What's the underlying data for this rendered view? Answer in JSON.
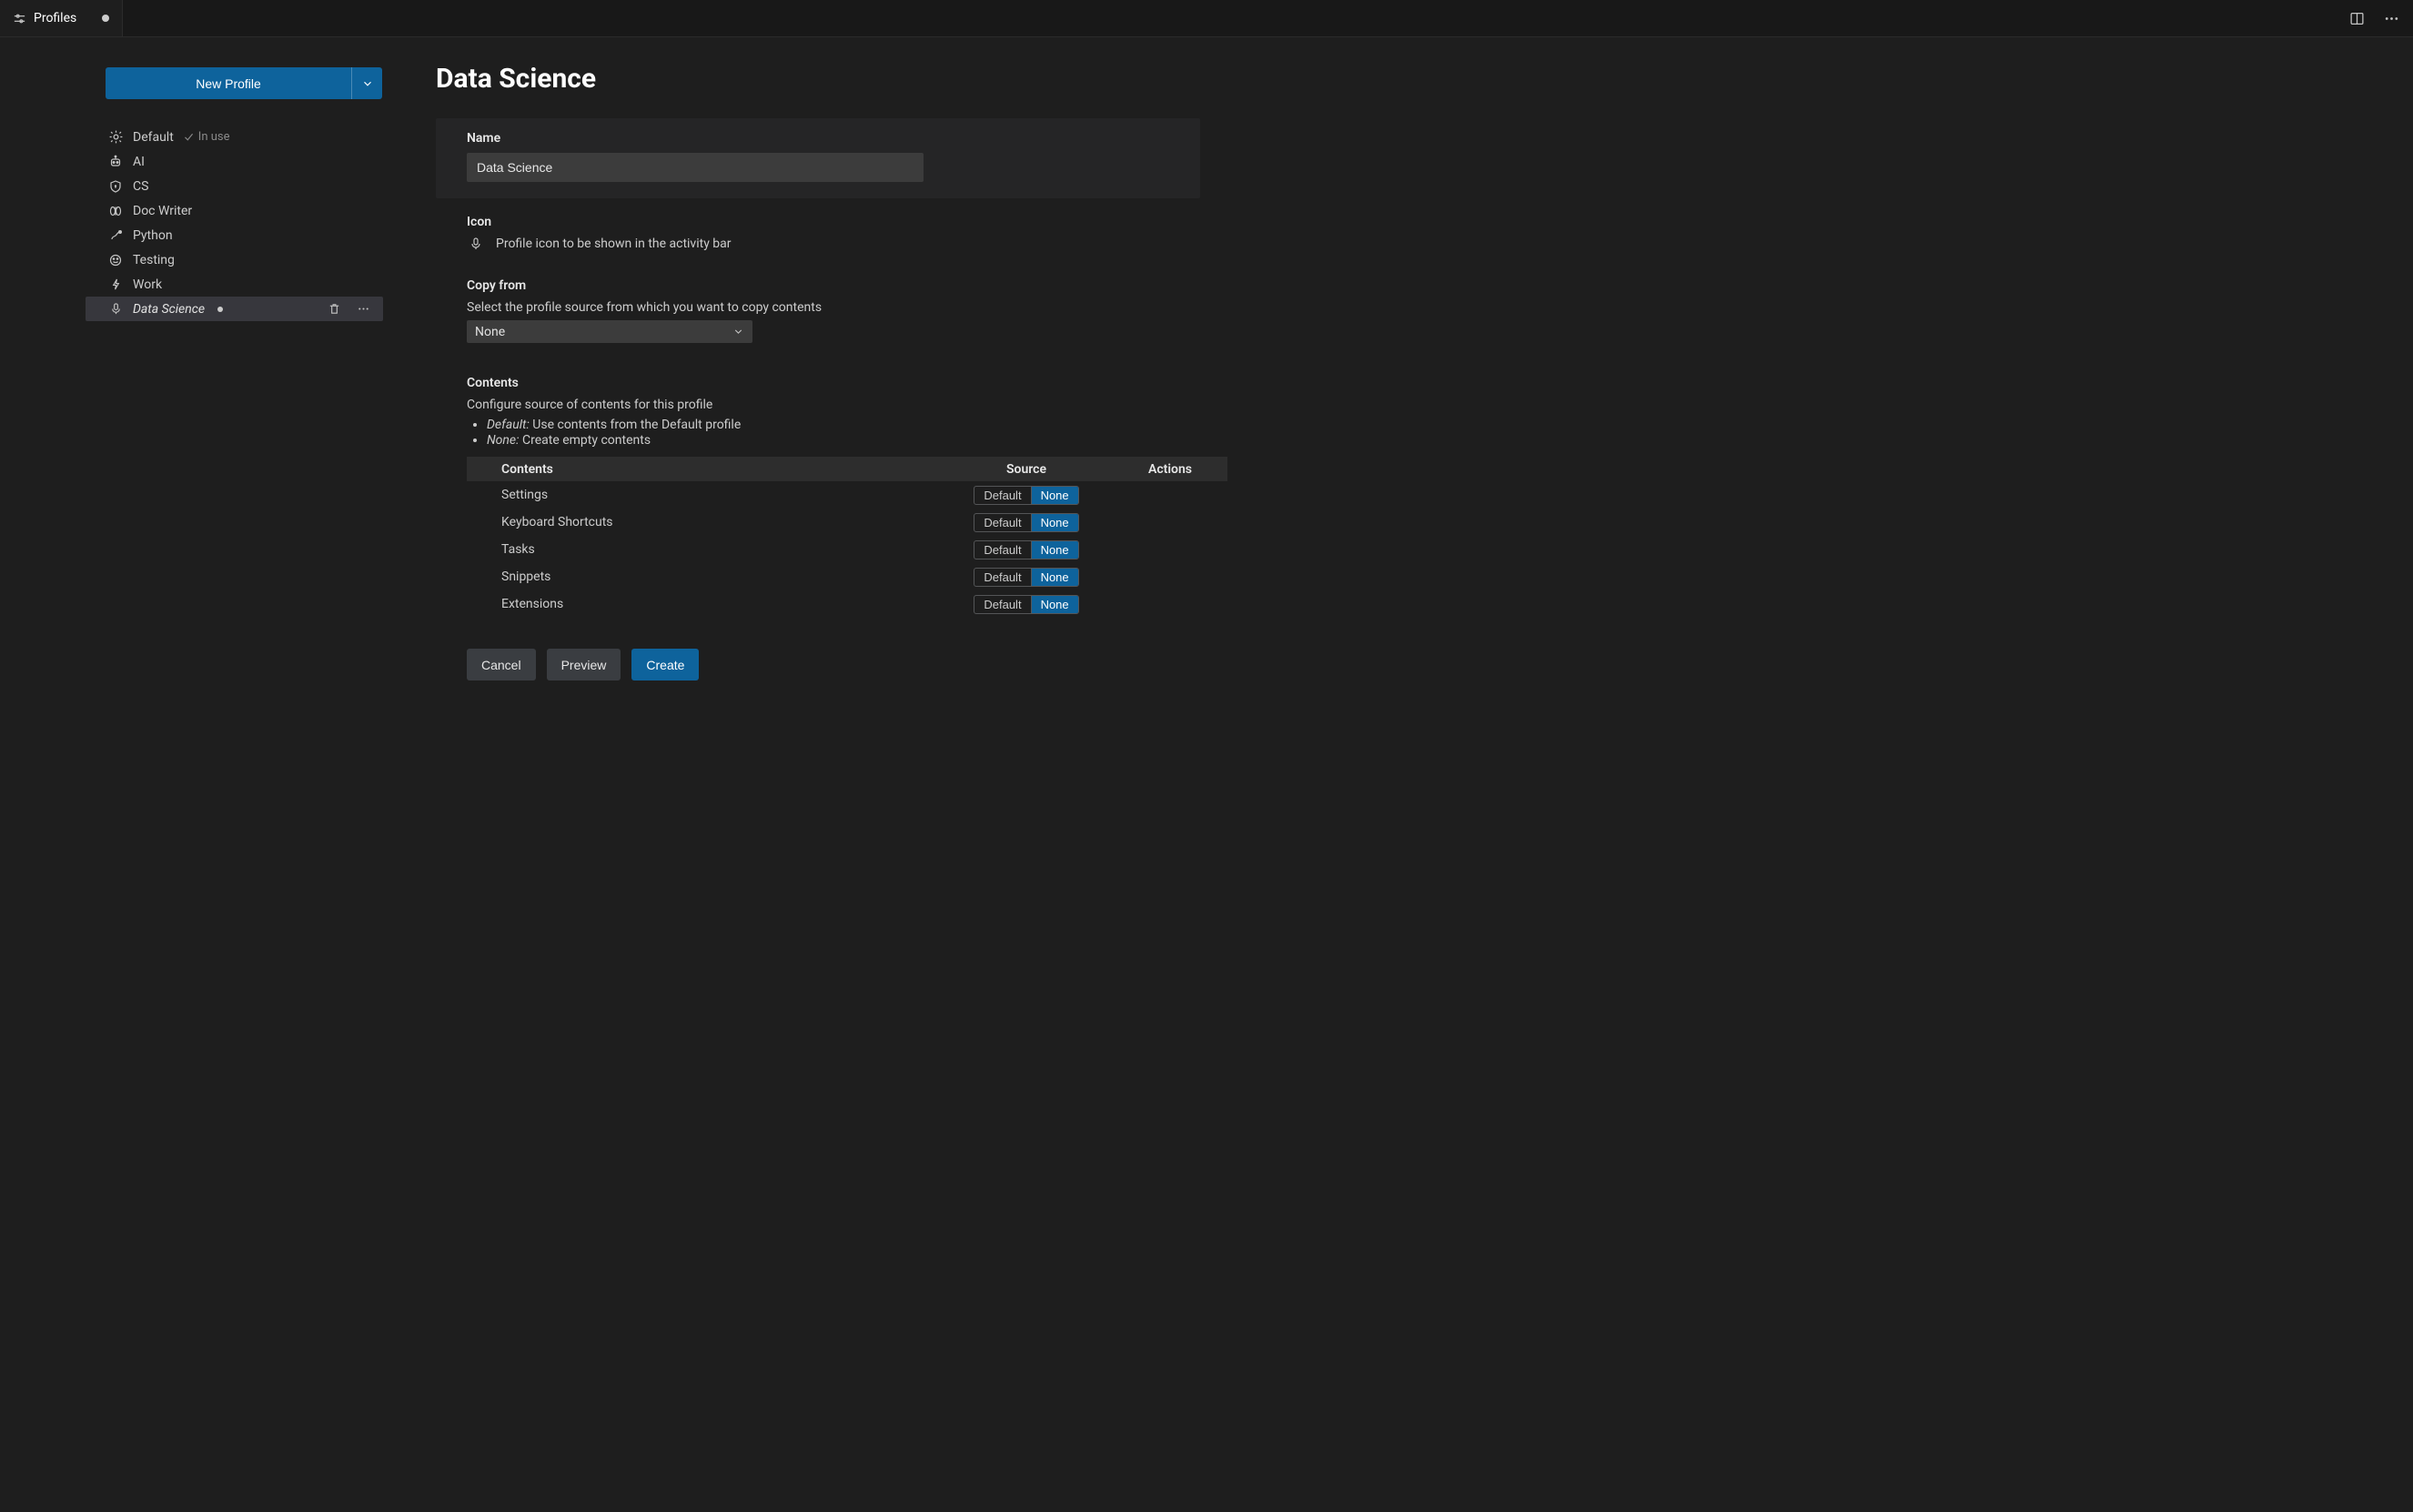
{
  "tab": {
    "title": "Profiles"
  },
  "sidebar": {
    "new_profile_label": "New Profile",
    "items": [
      {
        "label": "Default",
        "icon": "gear-icon",
        "status": "In use"
      },
      {
        "label": "AI",
        "icon": "robot-icon"
      },
      {
        "label": "CS",
        "icon": "shield-icon"
      },
      {
        "label": "Doc Writer",
        "icon": "book-icon"
      },
      {
        "label": "Python",
        "icon": "snake-icon"
      },
      {
        "label": "Testing",
        "icon": "smiley-icon"
      },
      {
        "label": "Work",
        "icon": "bolt-icon"
      },
      {
        "label": "Data Science",
        "icon": "mic-icon",
        "modified": true
      }
    ]
  },
  "page": {
    "title": "Data Science",
    "name_section": {
      "label": "Name",
      "value": "Data Science"
    },
    "icon_section": {
      "label": "Icon",
      "hint": "Profile icon to be shown in the activity bar",
      "icon": "mic-icon"
    },
    "copy_from": {
      "label": "Copy from",
      "hint": "Select the profile source from which you want to copy contents",
      "value": "None"
    },
    "contents": {
      "label": "Contents",
      "hint": "Configure source of contents for this profile",
      "bullet_default_label": "Default:",
      "bullet_default_text": "Use contents from the Default profile",
      "bullet_none_label": "None:",
      "bullet_none_text": "Create empty contents",
      "columns": {
        "contents": "Contents",
        "source": "Source",
        "actions": "Actions"
      },
      "source_options": {
        "default": "Default",
        "none": "None"
      },
      "rows": [
        {
          "label": "Settings",
          "source": "None"
        },
        {
          "label": "Keyboard Shortcuts",
          "source": "None"
        },
        {
          "label": "Tasks",
          "source": "None"
        },
        {
          "label": "Snippets",
          "source": "None"
        },
        {
          "label": "Extensions",
          "source": "None"
        }
      ]
    },
    "buttons": {
      "cancel": "Cancel",
      "preview": "Preview",
      "create": "Create"
    }
  }
}
